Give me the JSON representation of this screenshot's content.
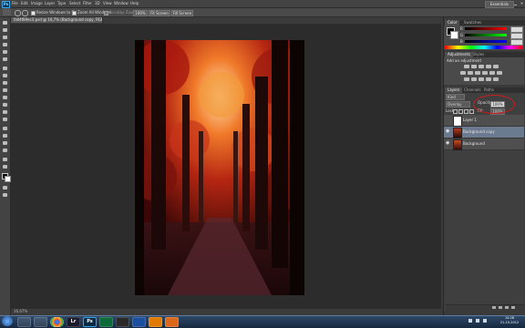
{
  "app": {
    "logo_text": "Ps"
  },
  "menu": [
    "File",
    "Edit",
    "Image",
    "Layer",
    "Type",
    "Select",
    "Filter",
    "3D",
    "View",
    "Window",
    "Help"
  ],
  "workspace": "Essentials",
  "options_bar": {
    "resize_windows_label": "Resize Windows to Fit",
    "zoom_all_windows_label": "Zoom All Windows",
    "scrubby_zoom_label": "Scrubby Zoom",
    "buttons": [
      "100%",
      "Fit Screen",
      "Fill Screen"
    ]
  },
  "document": {
    "tab_title": "fall4f89ec3.psd @ 16,7% (Background copy, RGB/16*) *",
    "status": "16,67%"
  },
  "colors": {
    "accent_red_annotation": "#d11a1a",
    "foreground": "#000000",
    "background": "#ffffff"
  },
  "color_panel": {
    "tabs": [
      "Color",
      "Swatches"
    ],
    "channels": [
      {
        "label": "R",
        "gradient": "red"
      },
      {
        "label": "G",
        "gradient": "green"
      },
      {
        "label": "B",
        "gradient": "blue"
      }
    ]
  },
  "adjustments_panel": {
    "tabs": [
      "Adjustments",
      "Styles"
    ],
    "title": "Add an adjustment"
  },
  "layers_panel": {
    "tabs": [
      "Layers",
      "Channels",
      "Paths"
    ],
    "kind_filter": "Kind",
    "blend_mode": "Overlay",
    "opacity_label": "Opacity:",
    "opacity_value": "100%",
    "lock_label": "Lock:",
    "fill_label": "Fill:",
    "fill_value": "100%",
    "layers": [
      {
        "name": "Layer 1",
        "selected": false,
        "visible": false
      },
      {
        "name": "Background copy",
        "selected": true,
        "visible": true
      },
      {
        "name": "Background",
        "selected": false,
        "visible": true
      }
    ]
  },
  "taskbar": {
    "apps": [
      "IE",
      "Explorer",
      "Chrome",
      "Lr",
      "Ps",
      "Media",
      "Video",
      "Word",
      "VLC",
      "Firefox"
    ],
    "time": "14:28",
    "date": "21-10-2012"
  }
}
